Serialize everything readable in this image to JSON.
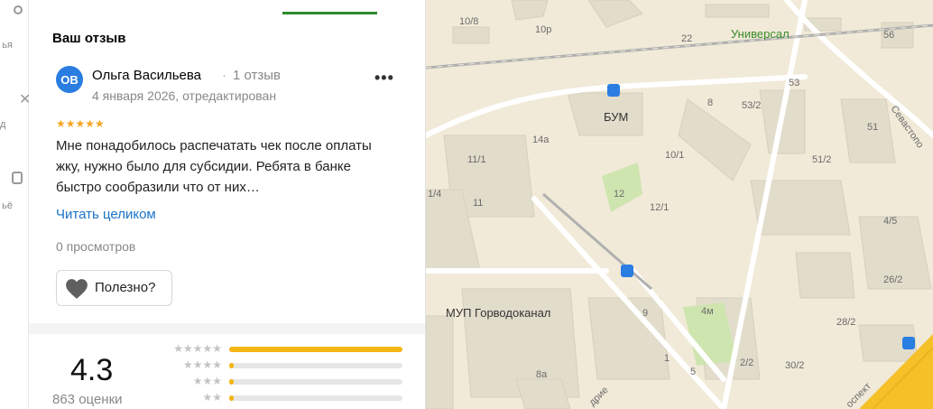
{
  "left_strip": {
    "items": [
      {
        "label": "ья",
        "icon": "person-icon"
      },
      {
        "label": "д",
        "icon": "route-icon"
      },
      {
        "label": "ьё",
        "icon": "phone-icon"
      }
    ]
  },
  "review": {
    "section_title": "Ваш отзыв",
    "avatar_initials": "ОВ",
    "author_name": "Ольга Васильева",
    "author_separator": "·",
    "author_reviews": "1 отзыв",
    "date": "4 января 2026, отредактирован",
    "stars": "★★★★★",
    "rating": 5,
    "text": "Мне понадобилось распечатать чек после оплаты жку, нужно было для субсидии. Ребята в банке быстро сообразили что от них…",
    "read_more": "Читать целиком",
    "views": "0 просмотров",
    "useful_label": "Полезно?",
    "more_icon": "more-dots-icon"
  },
  "summary": {
    "rating_value": "4.3",
    "rating_count": "863 оценки"
  },
  "chart_data": {
    "type": "bar",
    "orientation": "horizontal",
    "categories": [
      "★★★★★",
      "★★★★",
      "★★★",
      "★★"
    ],
    "values": [
      1.0,
      0.02,
      0.02,
      0.02
    ],
    "xlim": [
      0,
      1
    ]
  },
  "map": {
    "labels": {
      "l1": "10/8",
      "l2": "10р",
      "l3": "22",
      "l4": "Универсал",
      "l5": "56",
      "l6": "53",
      "l7": "8",
      "l8": "53/2",
      "l9": "БУМ",
      "l10": "14а",
      "l11": "51",
      "l12": "Севастопо",
      "l13": "11/1",
      "l14": "10/1",
      "l15": "51/2",
      "l16": "12",
      "l17": "1/4",
      "l18": "11",
      "l19": "12/1",
      "l20": "4/5",
      "l21": "26/2",
      "l22": "МУП Горводоканал",
      "l23": "9",
      "l24": "4м",
      "l25": "28/2",
      "l26": "1",
      "l27": "2/2",
      "l28": "30/2",
      "l29": "5",
      "l30": "8а",
      "l31": "дрие",
      "l32": "оспект"
    },
    "colors": {
      "background": "#f1ead8",
      "road": "#ffffff",
      "building": "#e2dccb",
      "park": "#cfe5b0",
      "highway": "#f5c028",
      "railway": "#a8a8a8",
      "transit": "#2a7de1"
    }
  }
}
